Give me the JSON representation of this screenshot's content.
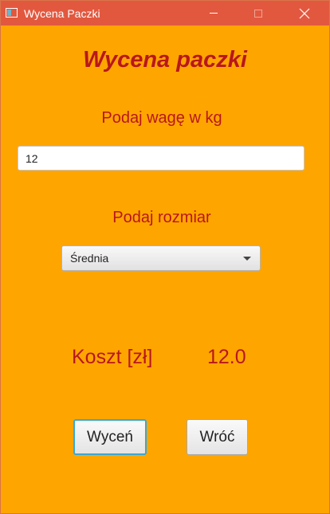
{
  "window": {
    "title": "Wycena Paczki",
    "controls": {
      "minimize_icon": "minimize-icon",
      "maximize_icon": "maximize-icon",
      "close_icon": "close-icon"
    }
  },
  "form": {
    "heading": "Wycena paczki",
    "weight_label": "Podaj wagę w kg",
    "weight_value": "12",
    "size_label": "Podaj rozmiar",
    "size_selected": "Średnia"
  },
  "result": {
    "cost_label": "Koszt [zł]",
    "cost_value": "12.0"
  },
  "buttons": {
    "price_label": "Wyceń",
    "back_label": "Wróć"
  },
  "colors": {
    "background": "#ffa500",
    "titlebar": "#e2583f",
    "accent_text": "#b8171b",
    "focus_border": "#39a7d9"
  }
}
